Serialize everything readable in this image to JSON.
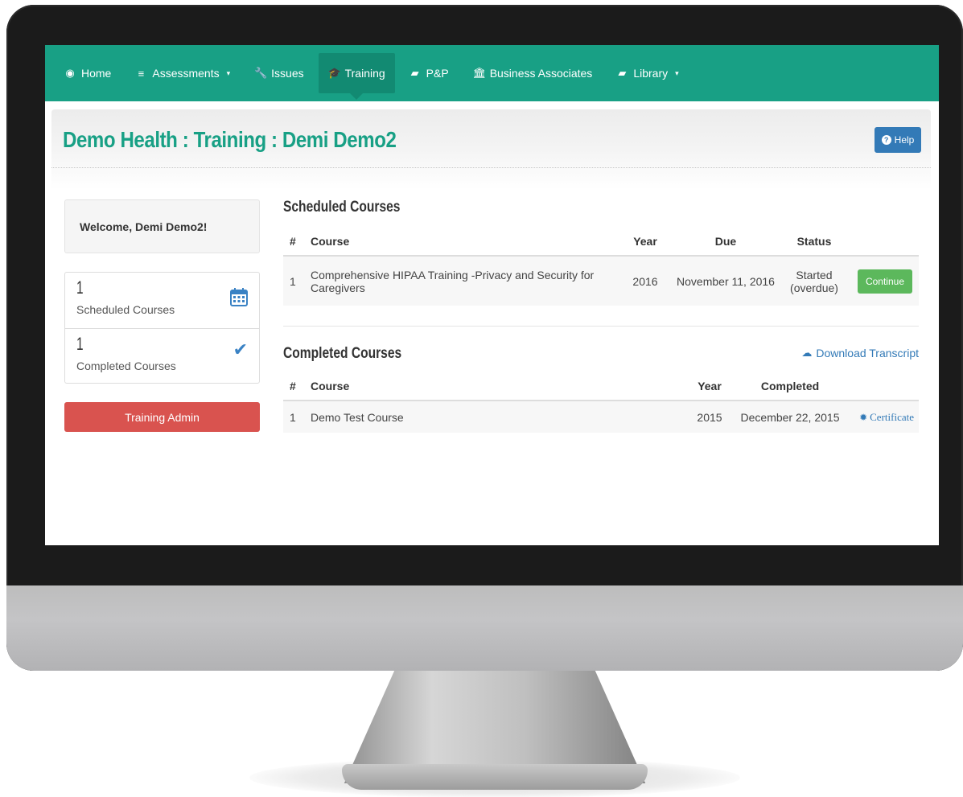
{
  "nav": {
    "items": [
      {
        "label": "Home",
        "icon": "dashboard-icon",
        "glyph": "◉"
      },
      {
        "label": "Assessments",
        "icon": "list-icon",
        "glyph": "≡",
        "caret": "▾"
      },
      {
        "label": "Issues",
        "icon": "wrench-icon",
        "glyph": "🔧"
      },
      {
        "label": "Training",
        "icon": "graduation-cap-icon",
        "glyph": "🎓",
        "active": true
      },
      {
        "label": "P&P",
        "icon": "book-icon",
        "glyph": "▰"
      },
      {
        "label": "Business Associates",
        "icon": "bank-icon",
        "glyph": "🏛"
      },
      {
        "label": "Library",
        "icon": "book-icon",
        "glyph": "▰",
        "caret": "▾"
      }
    ],
    "color": "#18a085"
  },
  "header": {
    "title": "Demo Health : Training : Demi Demo2",
    "help_label": "Help"
  },
  "sidebar": {
    "welcome": "Welcome, Demi Demo2!",
    "stats": [
      {
        "count": "1",
        "label": "Scheduled Courses",
        "icon": "calendar-icon"
      },
      {
        "count": "1",
        "label": "Completed Courses",
        "icon": "check-icon"
      }
    ],
    "admin_button": "Training Admin"
  },
  "scheduled": {
    "title": "Scheduled Courses",
    "columns": {
      "num": "#",
      "course": "Course",
      "year": "Year",
      "due": "Due",
      "status": "Status"
    },
    "rows": [
      {
        "num": "1",
        "course": "Comprehensive HIPAA Training -Privacy and Security for Caregivers",
        "year": "2016",
        "due": "November 11, 2016",
        "status": "Started (overdue)",
        "action": "Continue"
      }
    ]
  },
  "completed": {
    "title": "Completed Courses",
    "download_label": "Download Transcript",
    "columns": {
      "num": "#",
      "course": "Course",
      "year": "Year",
      "completed": "Completed"
    },
    "rows": [
      {
        "num": "1",
        "course": "Demo Test Course",
        "year": "2015",
        "completed": "December 22, 2015",
        "action": "Certificate"
      }
    ]
  },
  "colors": {
    "brand": "#18a085",
    "primary": "#337ab7",
    "success": "#5cb85c",
    "danger": "#d9534f"
  }
}
